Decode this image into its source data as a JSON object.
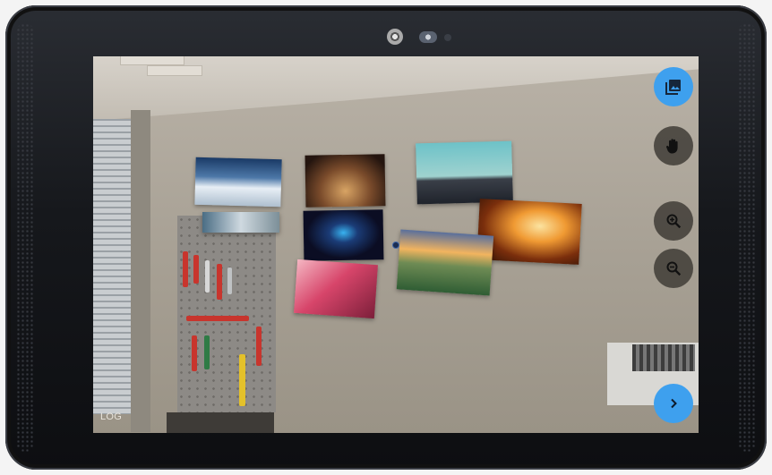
{
  "device": {
    "icons": [
      "camera-icon",
      "flash-icon",
      "light-sensor-icon"
    ]
  },
  "ar_view": {
    "photos": [
      {
        "name": "snowy-mountain-photo",
        "colors": [
          "#1a3a66",
          "#dfe9f3"
        ]
      },
      {
        "name": "orchestra-concert-photo",
        "colors": [
          "#2c1b14",
          "#d1a56b"
        ]
      },
      {
        "name": "desert-road-photo",
        "colors": [
          "#6bbec4",
          "#2a2f3a"
        ]
      },
      {
        "name": "misty-landscape-photo",
        "colors": [
          "#3a5a70",
          "#d7e0e6"
        ]
      },
      {
        "name": "concert-stage-blue-photo",
        "colors": [
          "#0a0c22",
          "#2aa0e8"
        ]
      },
      {
        "name": "fire-blacksmith-photo",
        "colors": [
          "#3b1607",
          "#f4a43a"
        ]
      },
      {
        "name": "sunset-hills-photo",
        "colors": [
          "#f1b45e",
          "#3c6a3a"
        ]
      },
      {
        "name": "pink-forest-photo",
        "colors": [
          "#d94a66",
          "#f7b2bd"
        ]
      }
    ],
    "log_label": "LOG"
  },
  "controls": {
    "gallery_icon": "gallery-icon",
    "hand_icon": "hand-icon",
    "zoom_in_icon": "zoom-in-icon",
    "zoom_out_icon": "zoom-out-icon",
    "next_icon": "chevron-right-icon",
    "accent_color": "#3ea0ee"
  }
}
